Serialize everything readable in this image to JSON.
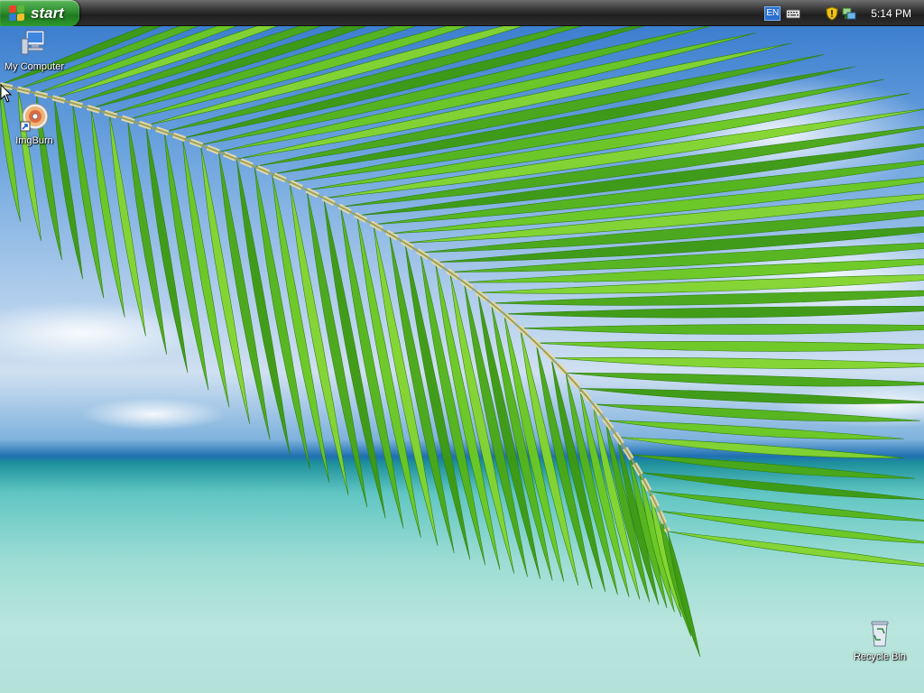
{
  "taskbar": {
    "start_label": "start",
    "tray": {
      "language": "EN",
      "clock": "5:14 PM",
      "icons": [
        "language-indicator",
        "keyboard-icon",
        "security-shield-icon",
        "network-icon"
      ]
    }
  },
  "desktop": {
    "wallpaper": "palm-leaf-over-tropical-beach",
    "icons": [
      {
        "label": "My Computer",
        "icon": "computer-icon"
      },
      {
        "label": "ImgBurn",
        "icon": "disc-icon"
      },
      {
        "label": "Recycle Bin",
        "icon": "recycle-bin-icon"
      }
    ]
  },
  "colors": {
    "start_green": "#2f8f2f",
    "taskbar_dark": "#1f1f1f",
    "leaf_green": "#5bbf1e",
    "sea_turquoise": "#8fd8cf",
    "sky_blue": "#3d7fcf"
  }
}
